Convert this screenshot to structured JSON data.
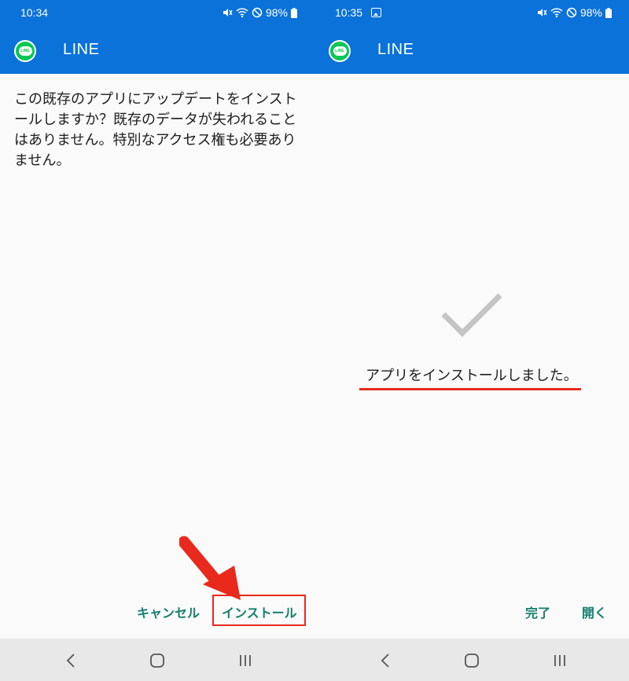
{
  "left_screen": {
    "status": {
      "time": "10:34",
      "battery": "98%"
    },
    "appbar": {
      "title": "LINE",
      "logo_text": "LINE"
    },
    "message": "この既存のアプリにアップデートをインストールしますか？既存のデータが失われることはありません。特別なアクセス権も必要ありません。",
    "buttons": {
      "cancel": "キャンセル",
      "install": "インストール"
    }
  },
  "right_screen": {
    "status": {
      "time": "10:35",
      "battery": "98%"
    },
    "appbar": {
      "title": "LINE",
      "logo_text": "LINE"
    },
    "done_message": "アプリをインストールしました。",
    "buttons": {
      "done": "完了",
      "open": "開く"
    }
  },
  "colors": {
    "appbar": "#0a72d8",
    "button_text": "#137f6c",
    "annotation_red": "#e8291c",
    "line_green": "#06c755"
  },
  "icons": [
    "mute-icon",
    "wifi-icon",
    "dnd-icon",
    "battery-icon",
    "gallery-icon",
    "check-icon",
    "back-icon",
    "home-icon",
    "recents-icon"
  ]
}
